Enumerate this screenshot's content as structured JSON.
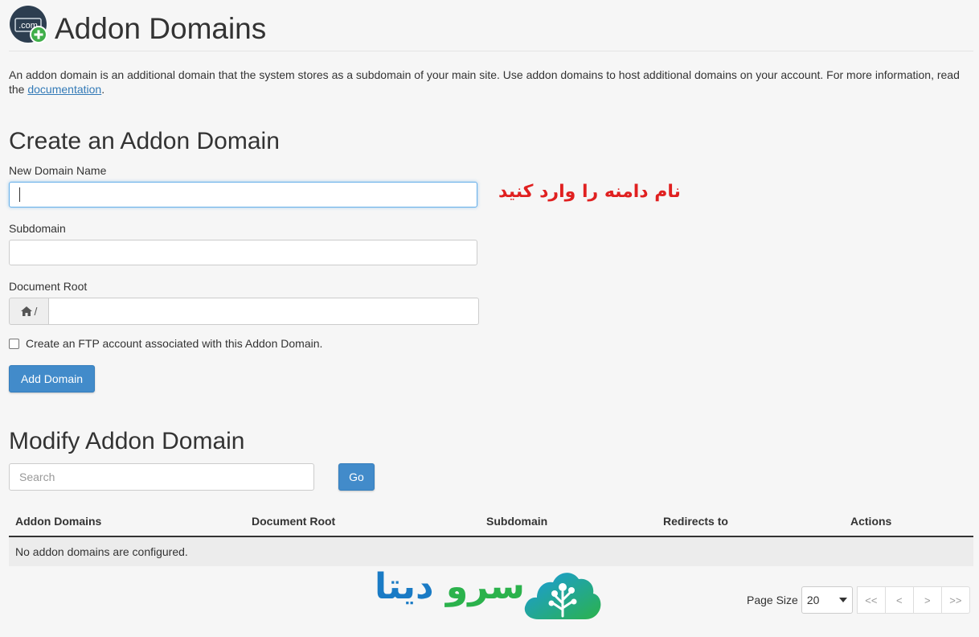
{
  "header": {
    "icon_text": ".com",
    "title": "Addon Domains"
  },
  "intro": {
    "text": "An addon domain is an additional domain that the system stores as a subdomain of your main site. Use addon domains to host additional domains on your account. For more information, read the ",
    "link": "documentation",
    "end": "."
  },
  "create": {
    "heading": "Create an Addon Domain",
    "new_domain_label": "New Domain Name",
    "new_domain_value": "",
    "annotation": "نام دامنه را وارد کنید",
    "subdomain_label": "Subdomain",
    "subdomain_value": "",
    "docroot_label": "Document Root",
    "docroot_prefix": "/",
    "docroot_value": "",
    "ftp_checkbox_label": "Create an FTP account associated with this Addon Domain.",
    "ftp_checked": false,
    "submit_label": "Add Domain"
  },
  "modify": {
    "heading": "Modify Addon Domain",
    "search_placeholder": "Search",
    "go_label": "Go",
    "columns": [
      "Addon Domains",
      "Document Root",
      "Subdomain",
      "Redirects to",
      "Actions"
    ],
    "empty_message": "No addon domains are configured."
  },
  "logo": {
    "text_part1": "سرو",
    "text_part2": "دیتا"
  },
  "pagination": {
    "page_size_label": "Page Size",
    "page_size_value": "20",
    "first": "<<",
    "prev": "<",
    "next": ">",
    "last": ">>"
  },
  "colors": {
    "primary_button": "#428bca",
    "annotation": "#e02020",
    "logo_blue": "#1a7bc5",
    "logo_green": "#2bb24c"
  }
}
